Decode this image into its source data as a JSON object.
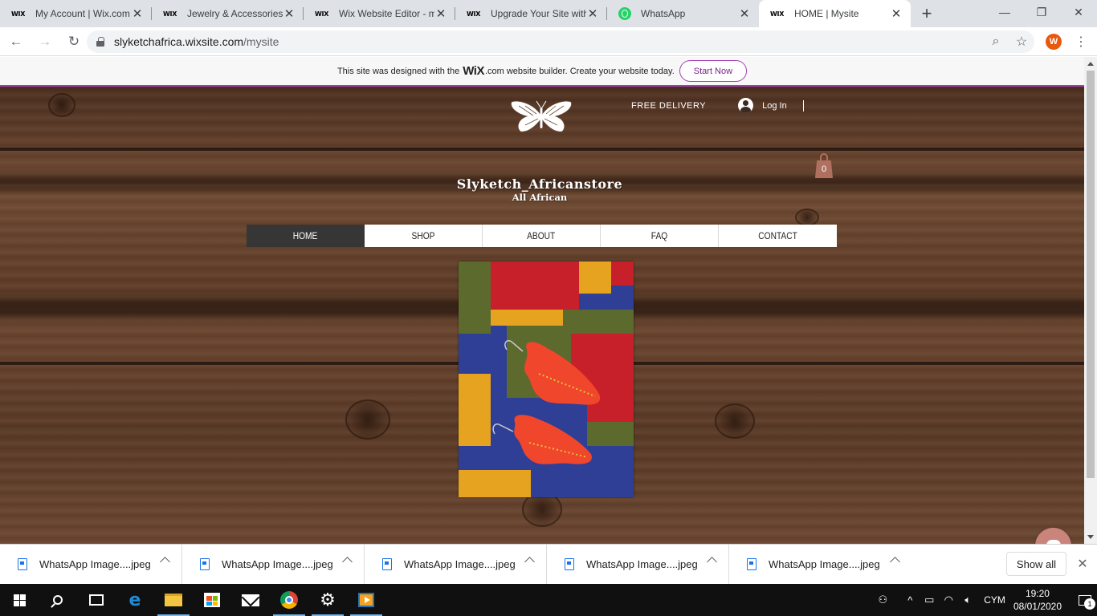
{
  "browser": {
    "tabs": [
      {
        "title": "My Account | Wix.com",
        "favicon": "wix-favicon",
        "active": false
      },
      {
        "title": "Jewelry & Accessories W",
        "favicon": "wix-favicon",
        "active": false
      },
      {
        "title": "Wix Website Editor - m",
        "favicon": "wix-favicon",
        "active": false
      },
      {
        "title": "Upgrade Your Site with",
        "favicon": "wix-favicon",
        "active": false
      },
      {
        "title": "WhatsApp",
        "favicon": "whatsapp-favicon",
        "active": false
      },
      {
        "title": "HOME | Mysite",
        "favicon": "wix-favicon",
        "active": true
      }
    ],
    "favicon_text": "WIX",
    "url_host": "slyketchafrica.wixsite.com",
    "url_path": "/mysite",
    "profile_initial": "W"
  },
  "wix_banner": {
    "text_before": "This site was designed with the",
    "logo": "WiX",
    "text_after": ".com website builder. Create your website today.",
    "button": "Start Now"
  },
  "site": {
    "free_delivery": "FREE DELIVERY",
    "login": "Log In",
    "brand_name": "Slyketch_Africanstore",
    "brand_tagline": "All African",
    "cart_count": "0",
    "menu": [
      {
        "label": "HOME",
        "active": true
      },
      {
        "label": "SHOP",
        "active": false
      },
      {
        "label": "ABOUT",
        "active": false
      },
      {
        "label": "FAQ",
        "active": false
      },
      {
        "label": "CONTACT",
        "active": false
      }
    ],
    "colors": {
      "accent": "#a23db3",
      "cart": "#b07060",
      "chat": "#c9857b",
      "menu_active": "#363636"
    }
  },
  "downloads": {
    "items": [
      {
        "name": "WhatsApp Image....jpeg"
      },
      {
        "name": "WhatsApp Image....jpeg"
      },
      {
        "name": "WhatsApp Image....jpeg"
      },
      {
        "name": "WhatsApp Image....jpeg"
      },
      {
        "name": "WhatsApp Image....jpeg"
      }
    ],
    "show_all": "Show all"
  },
  "taskbar": {
    "language": "CYM",
    "time": "19:20",
    "date": "08/01/2020",
    "notification_count": "1"
  }
}
